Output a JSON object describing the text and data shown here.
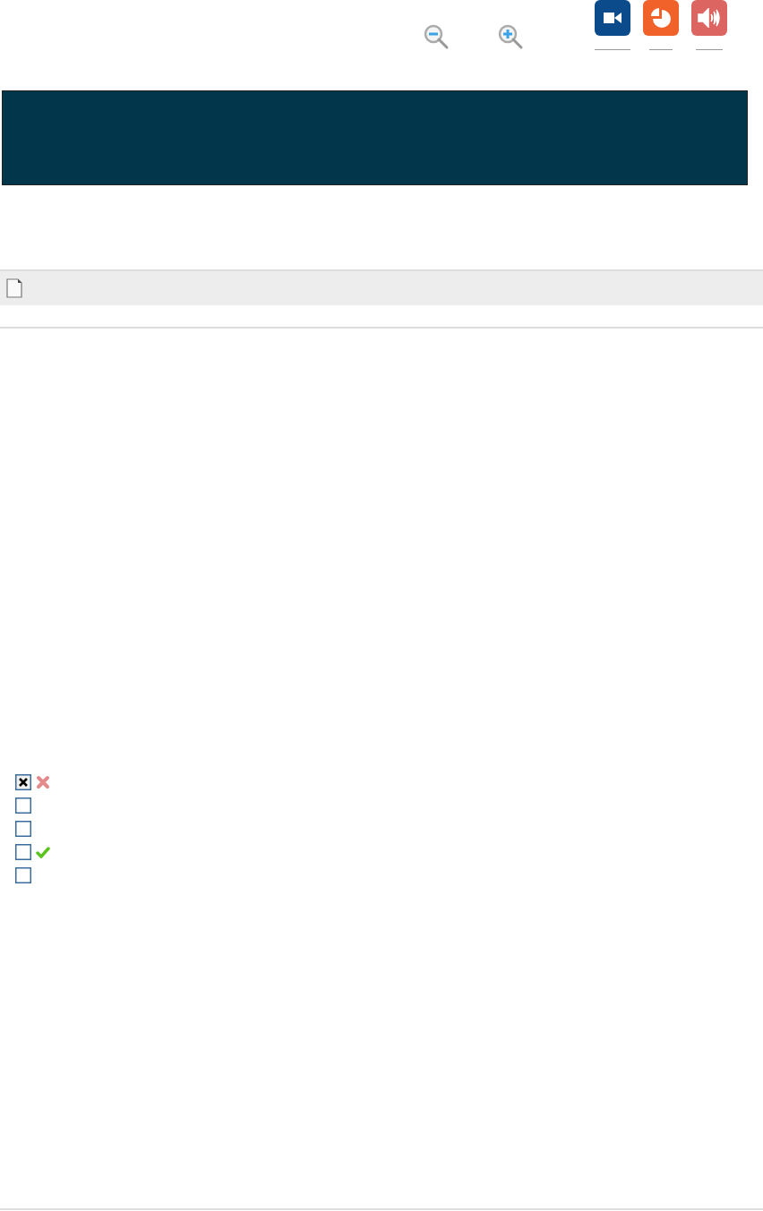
{
  "toolbar": {
    "media_buttons": [
      {
        "kind": "video",
        "color": "#0b4a8b"
      },
      {
        "kind": "pie",
        "color": "#f0622a"
      },
      {
        "kind": "sound",
        "color": "#dc6461"
      }
    ]
  },
  "options": [
    {
      "checked": true,
      "marked_wrong": true,
      "marked_correct": false
    },
    {
      "checked": false,
      "marked_wrong": false,
      "marked_correct": false
    },
    {
      "checked": false,
      "marked_wrong": false,
      "marked_correct": false
    },
    {
      "checked": false,
      "marked_wrong": false,
      "marked_correct": true
    },
    {
      "checked": false,
      "marked_wrong": false,
      "marked_correct": false
    }
  ]
}
